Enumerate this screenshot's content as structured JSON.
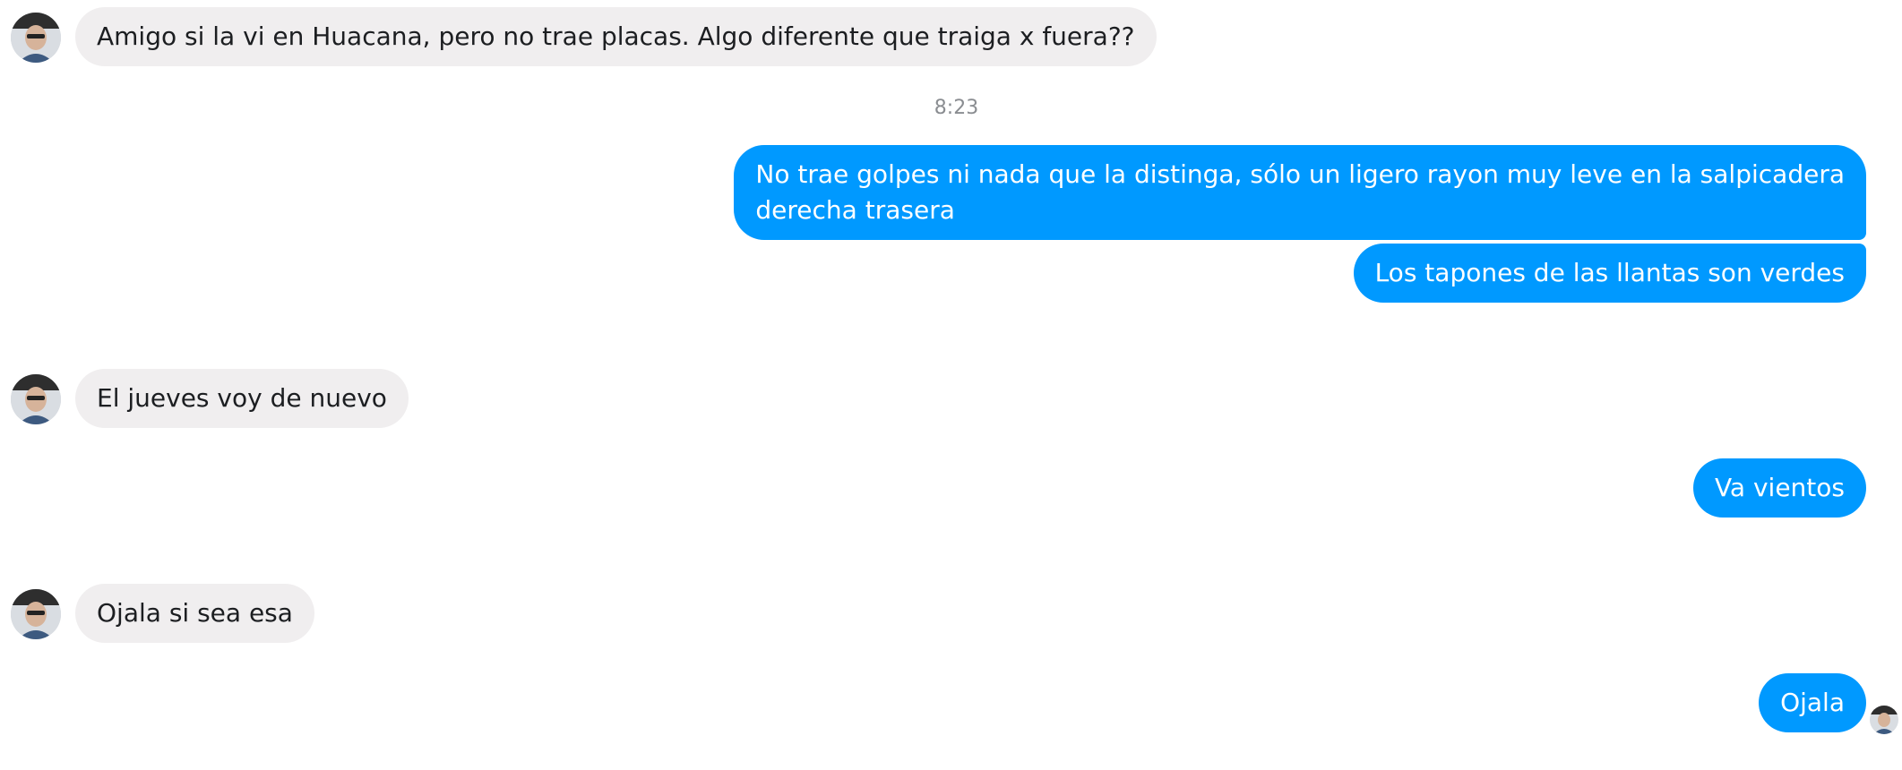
{
  "messages": [
    {
      "text": "Amigo si la vi en Huacana, pero no trae placas. Algo diferente que traiga x fuera??"
    },
    {
      "text": "8:23"
    },
    {
      "text_line1": "No trae golpes ni nada que la distinga, sólo un ligero rayon muy leve en la salpicadera",
      "text_line2": "derecha trasera"
    },
    {
      "text": "Los tapones de las llantas son verdes"
    },
    {
      "text": "El jueves voy de nuevo"
    },
    {
      "text": "Va vientos"
    },
    {
      "text": "Ojala si sea esa"
    },
    {
      "text": "Ojala"
    }
  ],
  "colors": {
    "incoming_bubble": "#f0eeef",
    "outgoing_bubble": "#0099ff",
    "timestamp": "#8a8d91"
  }
}
